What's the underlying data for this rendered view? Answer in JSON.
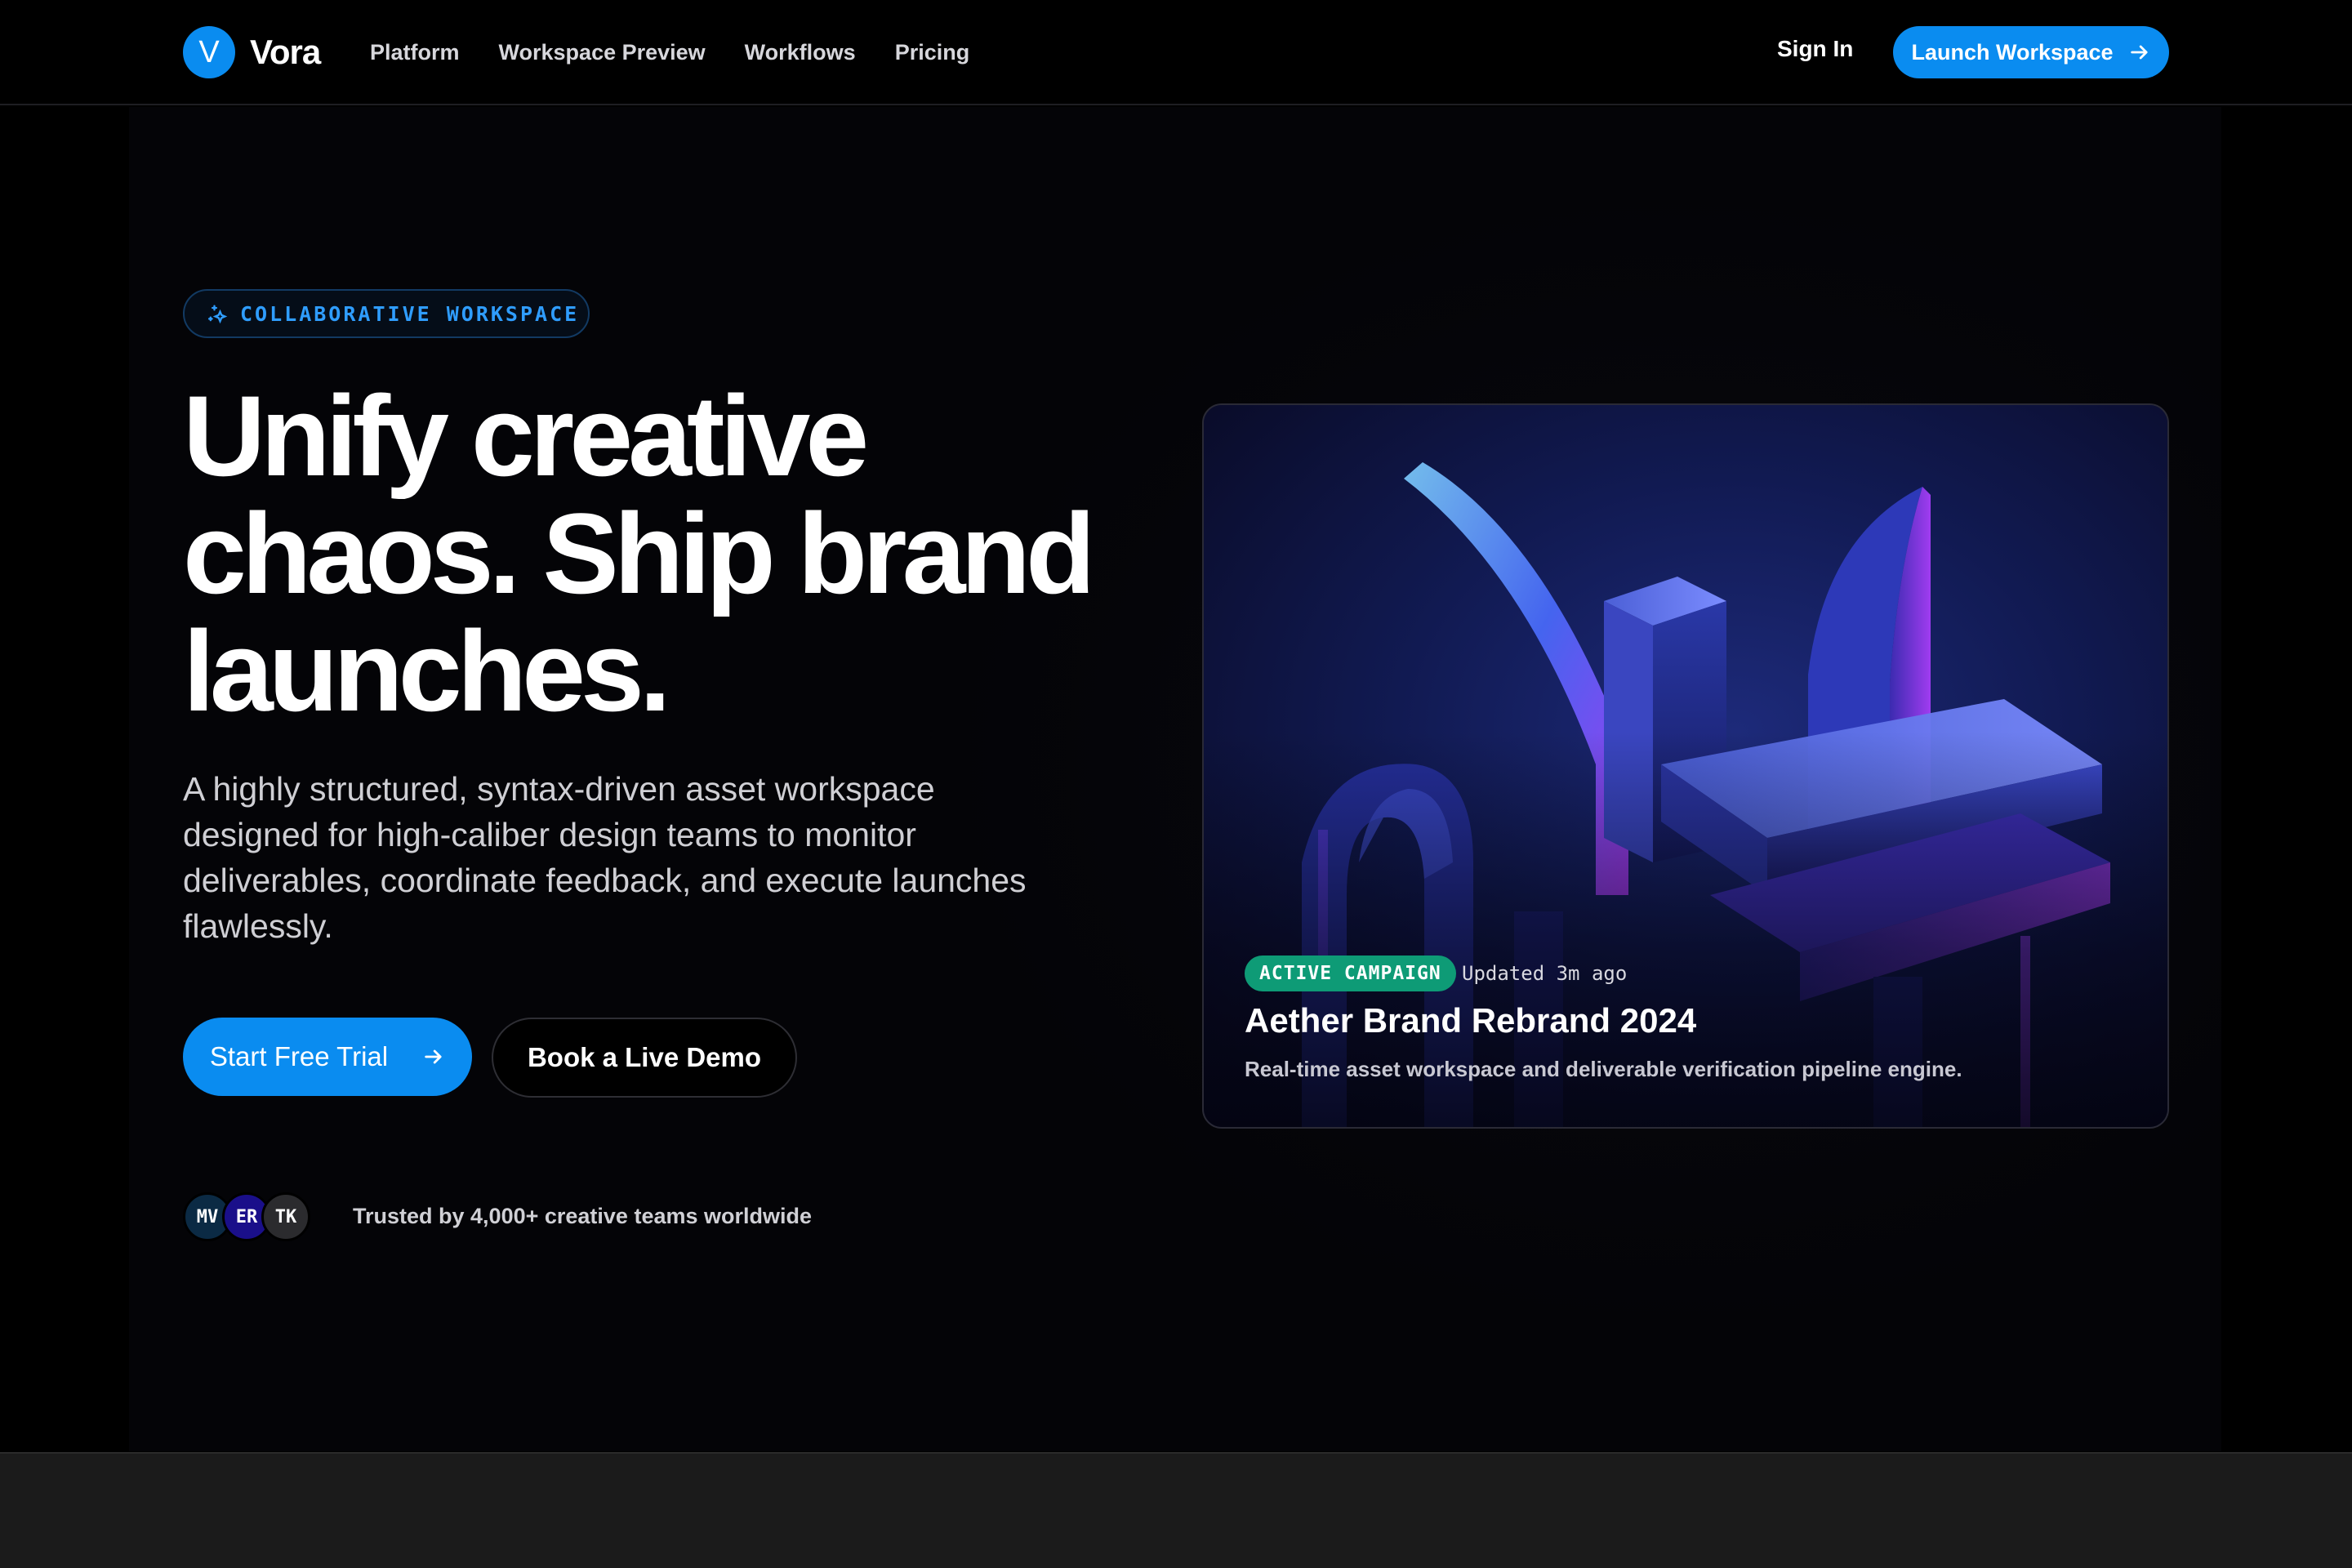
{
  "nav": {
    "brand_mark": "V",
    "brand_name": "Vora",
    "links": [
      "Platform",
      "Workspace Preview",
      "Workflows",
      "Pricing"
    ],
    "sign_in": "Sign In",
    "launch_label": "Launch Workspace"
  },
  "hero": {
    "badge": "COLLABORATIVE WORKSPACE",
    "headline_lines": [
      "Unify creative",
      "chaos. Ship brand",
      "launches."
    ],
    "lede": "A highly structured, syntax-driven asset workspace designed for high-caliber design teams to monitor deliverables, coordinate feedback, and execute launches flawlessly.",
    "cta_primary": "Start Free Trial",
    "cta_secondary": "Book a Live Demo",
    "avatars": [
      "MV",
      "ER",
      "TK"
    ],
    "trusted": "Trusted by 4,000+ creative teams worldwide"
  },
  "card": {
    "status": "ACTIVE CAMPAIGN",
    "updated": "Updated 3m ago",
    "title": "Aether Brand Rebrand 2024",
    "description": "Real-time asset workspace and deliverable verification pipeline engine."
  },
  "colors": {
    "accent": "#0a8cf0",
    "status_green": "#0e9b76",
    "badge_text": "#2f9dff"
  },
  "icons": {
    "brand": "v-logo-icon",
    "arrow": "arrow-right-icon",
    "badge": "sparkle-icon"
  }
}
